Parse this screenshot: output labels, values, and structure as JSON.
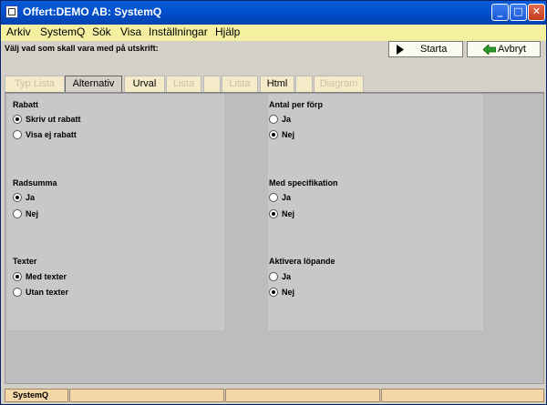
{
  "window": {
    "title": "Offert:DEMO AB: SystemQ"
  },
  "menu": [
    "Arkiv",
    "SystemQ",
    "Sök",
    "Visa",
    "Inställningar",
    "Hjälp"
  ],
  "prompt": "Välj vad som skall vara med på utskrift:",
  "buttons": {
    "start": "Starta",
    "cancel": "Avbryt"
  },
  "tabs": [
    {
      "label": "Typ Lista",
      "state": "disabled"
    },
    {
      "label": "Alternativ",
      "state": "active"
    },
    {
      "label": "Urval",
      "state": "enabled"
    },
    {
      "label": "Lista",
      "state": "disabled"
    },
    {
      "label": "",
      "state": "disabled"
    },
    {
      "label": "Lista",
      "state": "disabled"
    },
    {
      "label": "Html",
      "state": "enabled"
    },
    {
      "label": "",
      "state": "disabled"
    },
    {
      "label": "Diagram",
      "state": "disabled"
    }
  ],
  "groups": {
    "rabatt": {
      "label": "Rabatt",
      "options": [
        "Skriv ut rabatt",
        "Visa ej rabatt"
      ],
      "selected": 0
    },
    "radsumma": {
      "label": "Radsumma",
      "options": [
        "Ja",
        "Nej"
      ],
      "selected": 0
    },
    "texter": {
      "label": "Texter",
      "options": [
        "Med texter",
        "Utan texter"
      ],
      "selected": 0
    },
    "antal": {
      "label": "Antal per förp",
      "options": [
        "Ja",
        "Nej"
      ],
      "selected": 1
    },
    "spec": {
      "label": "Med specifikation",
      "options": [
        "Ja",
        "Nej"
      ],
      "selected": 1
    },
    "lopande": {
      "label": "Aktivera löpande",
      "options": [
        "Ja",
        "Nej"
      ],
      "selected": 1
    }
  },
  "status": [
    "SystemQ",
    "",
    "",
    ""
  ]
}
